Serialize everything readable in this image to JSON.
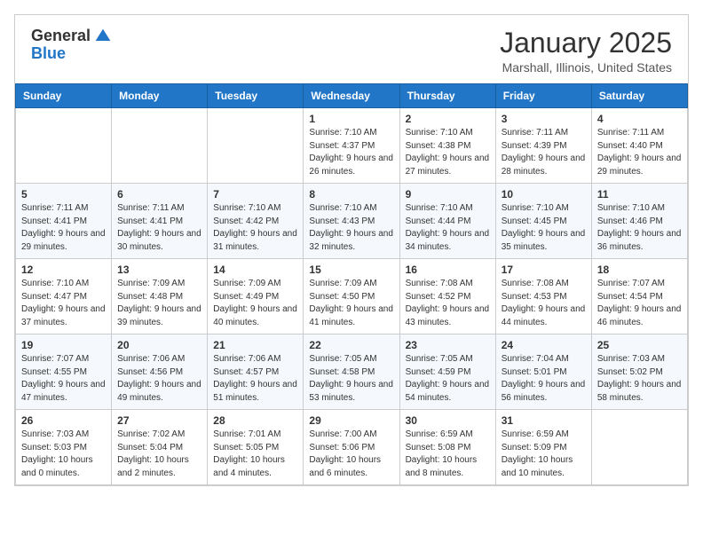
{
  "logo": {
    "general": "General",
    "blue": "Blue"
  },
  "header": {
    "month": "January 2025",
    "location": "Marshall, Illinois, United States"
  },
  "days_of_week": [
    "Sunday",
    "Monday",
    "Tuesday",
    "Wednesday",
    "Thursday",
    "Friday",
    "Saturday"
  ],
  "weeks": [
    [
      {
        "day": "",
        "info": ""
      },
      {
        "day": "",
        "info": ""
      },
      {
        "day": "",
        "info": ""
      },
      {
        "day": "1",
        "info": "Sunrise: 7:10 AM\nSunset: 4:37 PM\nDaylight: 9 hours and 26 minutes."
      },
      {
        "day": "2",
        "info": "Sunrise: 7:10 AM\nSunset: 4:38 PM\nDaylight: 9 hours and 27 minutes."
      },
      {
        "day": "3",
        "info": "Sunrise: 7:11 AM\nSunset: 4:39 PM\nDaylight: 9 hours and 28 minutes."
      },
      {
        "day": "4",
        "info": "Sunrise: 7:11 AM\nSunset: 4:40 PM\nDaylight: 9 hours and 29 minutes."
      }
    ],
    [
      {
        "day": "5",
        "info": "Sunrise: 7:11 AM\nSunset: 4:41 PM\nDaylight: 9 hours and 29 minutes."
      },
      {
        "day": "6",
        "info": "Sunrise: 7:11 AM\nSunset: 4:41 PM\nDaylight: 9 hours and 30 minutes."
      },
      {
        "day": "7",
        "info": "Sunrise: 7:10 AM\nSunset: 4:42 PM\nDaylight: 9 hours and 31 minutes."
      },
      {
        "day": "8",
        "info": "Sunrise: 7:10 AM\nSunset: 4:43 PM\nDaylight: 9 hours and 32 minutes."
      },
      {
        "day": "9",
        "info": "Sunrise: 7:10 AM\nSunset: 4:44 PM\nDaylight: 9 hours and 34 minutes."
      },
      {
        "day": "10",
        "info": "Sunrise: 7:10 AM\nSunset: 4:45 PM\nDaylight: 9 hours and 35 minutes."
      },
      {
        "day": "11",
        "info": "Sunrise: 7:10 AM\nSunset: 4:46 PM\nDaylight: 9 hours and 36 minutes."
      }
    ],
    [
      {
        "day": "12",
        "info": "Sunrise: 7:10 AM\nSunset: 4:47 PM\nDaylight: 9 hours and 37 minutes."
      },
      {
        "day": "13",
        "info": "Sunrise: 7:09 AM\nSunset: 4:48 PM\nDaylight: 9 hours and 39 minutes."
      },
      {
        "day": "14",
        "info": "Sunrise: 7:09 AM\nSunset: 4:49 PM\nDaylight: 9 hours and 40 minutes."
      },
      {
        "day": "15",
        "info": "Sunrise: 7:09 AM\nSunset: 4:50 PM\nDaylight: 9 hours and 41 minutes."
      },
      {
        "day": "16",
        "info": "Sunrise: 7:08 AM\nSunset: 4:52 PM\nDaylight: 9 hours and 43 minutes."
      },
      {
        "day": "17",
        "info": "Sunrise: 7:08 AM\nSunset: 4:53 PM\nDaylight: 9 hours and 44 minutes."
      },
      {
        "day": "18",
        "info": "Sunrise: 7:07 AM\nSunset: 4:54 PM\nDaylight: 9 hours and 46 minutes."
      }
    ],
    [
      {
        "day": "19",
        "info": "Sunrise: 7:07 AM\nSunset: 4:55 PM\nDaylight: 9 hours and 47 minutes."
      },
      {
        "day": "20",
        "info": "Sunrise: 7:06 AM\nSunset: 4:56 PM\nDaylight: 9 hours and 49 minutes."
      },
      {
        "day": "21",
        "info": "Sunrise: 7:06 AM\nSunset: 4:57 PM\nDaylight: 9 hours and 51 minutes."
      },
      {
        "day": "22",
        "info": "Sunrise: 7:05 AM\nSunset: 4:58 PM\nDaylight: 9 hours and 53 minutes."
      },
      {
        "day": "23",
        "info": "Sunrise: 7:05 AM\nSunset: 4:59 PM\nDaylight: 9 hours and 54 minutes."
      },
      {
        "day": "24",
        "info": "Sunrise: 7:04 AM\nSunset: 5:01 PM\nDaylight: 9 hours and 56 minutes."
      },
      {
        "day": "25",
        "info": "Sunrise: 7:03 AM\nSunset: 5:02 PM\nDaylight: 9 hours and 58 minutes."
      }
    ],
    [
      {
        "day": "26",
        "info": "Sunrise: 7:03 AM\nSunset: 5:03 PM\nDaylight: 10 hours and 0 minutes."
      },
      {
        "day": "27",
        "info": "Sunrise: 7:02 AM\nSunset: 5:04 PM\nDaylight: 10 hours and 2 minutes."
      },
      {
        "day": "28",
        "info": "Sunrise: 7:01 AM\nSunset: 5:05 PM\nDaylight: 10 hours and 4 minutes."
      },
      {
        "day": "29",
        "info": "Sunrise: 7:00 AM\nSunset: 5:06 PM\nDaylight: 10 hours and 6 minutes."
      },
      {
        "day": "30",
        "info": "Sunrise: 6:59 AM\nSunset: 5:08 PM\nDaylight: 10 hours and 8 minutes."
      },
      {
        "day": "31",
        "info": "Sunrise: 6:59 AM\nSunset: 5:09 PM\nDaylight: 10 hours and 10 minutes."
      },
      {
        "day": "",
        "info": ""
      }
    ]
  ]
}
